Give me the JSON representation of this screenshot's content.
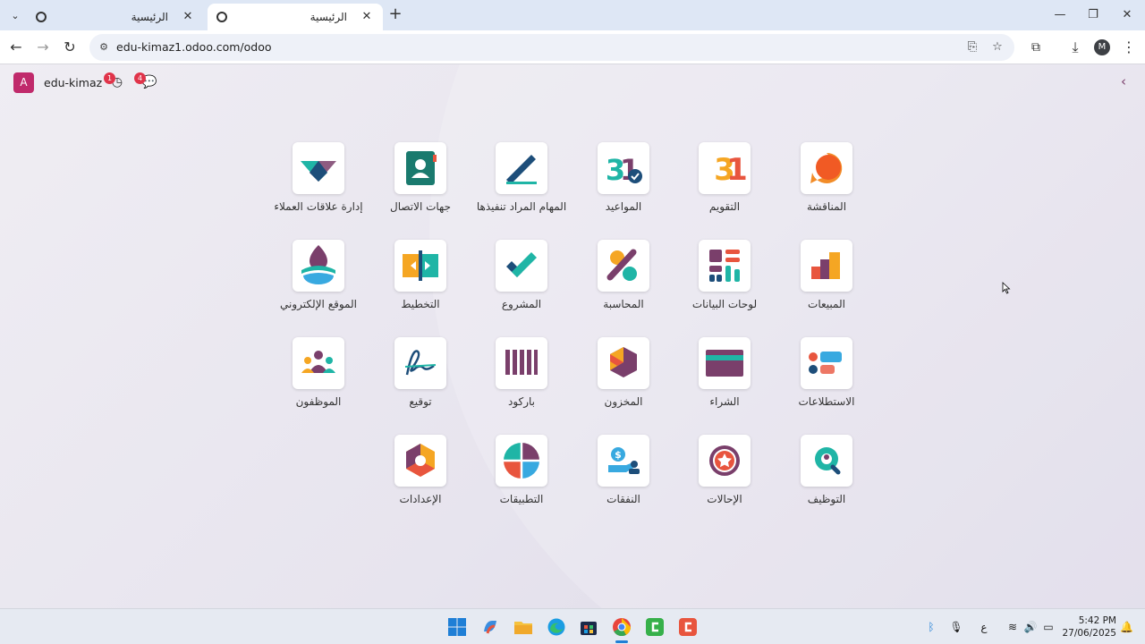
{
  "browser": {
    "tabs": [
      {
        "title": "الرئيسية",
        "active": false
      },
      {
        "title": "الرئيسية",
        "active": true
      }
    ],
    "url": "edu-kimaz1.odoo.com/odoo",
    "profile_initial": "M"
  },
  "odoo": {
    "company_initial": "A",
    "company_name": "edu-kimaz",
    "activity_count": "1",
    "messages_count": "4",
    "apps": [
      {
        "label": "المناقشة",
        "icon": "discuss-icon"
      },
      {
        "label": "التقويم",
        "icon": "calendar-icon"
      },
      {
        "label": "المواعيد",
        "icon": "appointments-icon"
      },
      {
        "label": "المهام المراد تنفيذها",
        "icon": "todo-icon"
      },
      {
        "label": "جهات الاتصال",
        "icon": "contacts-icon"
      },
      {
        "label": "إدارة علاقات العملاء",
        "icon": "crm-icon"
      },
      {
        "label": "المبيعات",
        "icon": "sales-icon"
      },
      {
        "label": "لوحات البيانات",
        "icon": "dashboards-icon"
      },
      {
        "label": "المحاسبة",
        "icon": "accounting-icon"
      },
      {
        "label": "المشروع",
        "icon": "project-icon"
      },
      {
        "label": "التخطيط",
        "icon": "planning-icon"
      },
      {
        "label": "الموقع الإلكتروني",
        "icon": "website-icon"
      },
      {
        "label": "الاستطلاعات",
        "icon": "surveys-icon"
      },
      {
        "label": "الشراء",
        "icon": "purchase-icon"
      },
      {
        "label": "المخزون",
        "icon": "inventory-icon"
      },
      {
        "label": "باركود",
        "icon": "barcode-icon"
      },
      {
        "label": "توقيع",
        "icon": "sign-icon"
      },
      {
        "label": "الموظفون",
        "icon": "employees-icon"
      },
      {
        "label": "التوظيف",
        "icon": "recruitment-icon"
      },
      {
        "label": "الإحالات",
        "icon": "referrals-icon"
      },
      {
        "label": "النفقات",
        "icon": "expenses-icon"
      },
      {
        "label": "التطبيقات",
        "icon": "apps-icon"
      },
      {
        "label": "الإعدادات",
        "icon": "settings-icon"
      }
    ]
  },
  "taskbar": {
    "input_lang": "ع",
    "time": "5:42 PM",
    "date": "27/06/2025"
  },
  "colors": {
    "odoo_accent": "#7a3f6b",
    "company_avatar": "#c02a6b",
    "badge": "#e0344a"
  }
}
